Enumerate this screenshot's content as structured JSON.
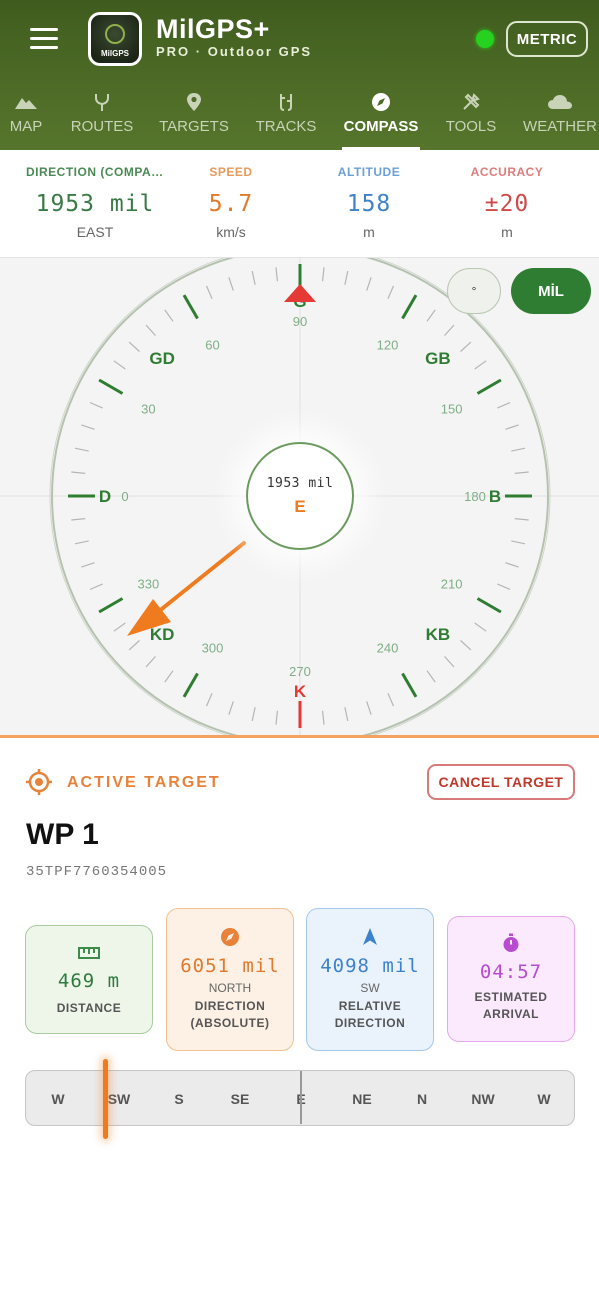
{
  "header": {
    "app_name": "MilGPS+",
    "logo_text": "MilGPS",
    "subtitle": "PRO · Outdoor GPS",
    "unit_button": "METRIC"
  },
  "tabs": [
    {
      "label": "MAP",
      "icon": "mountain-icon"
    },
    {
      "label": "ROUTES",
      "icon": "route-icon"
    },
    {
      "label": "TARGETS",
      "icon": "pin-icon"
    },
    {
      "label": "TRACKS",
      "icon": "tracks-icon"
    },
    {
      "label": "COMPASS",
      "icon": "compass-icon",
      "active": true
    },
    {
      "label": "TOOLS",
      "icon": "tools-icon"
    },
    {
      "label": "WEATHER",
      "icon": "cloud-icon"
    }
  ],
  "stats": {
    "direction": {
      "label": "DIRECTION (COMPASS)",
      "value": "1953 mil",
      "unit": "EAST"
    },
    "speed": {
      "label": "SPEED",
      "value": "5.7",
      "unit": "km/s"
    },
    "altitude": {
      "label": "ALTITUDE",
      "value": "158",
      "unit": "m"
    },
    "accuracy": {
      "label": "ACCURACY",
      "value": "±20",
      "unit": "m"
    }
  },
  "compass": {
    "unit_toggle": {
      "degree": "°",
      "mil": "MİL"
    },
    "center_value": "1953 mil",
    "center_direction": "E",
    "letters": [
      "D",
      "GD",
      "G",
      "GB",
      "B",
      "KB",
      "K",
      "KD"
    ],
    "numbers": [
      "0",
      "30",
      "60",
      "90",
      "120",
      "150",
      "180",
      "210",
      "240",
      "270",
      "300",
      "330"
    ]
  },
  "target": {
    "section_label": "ACTIVE TARGET",
    "cancel_label": "CANCEL TARGET",
    "name": "WP 1",
    "grid": "35TPF7760354005",
    "cards": {
      "distance": {
        "value": "469 m",
        "label": "DISTANCE"
      },
      "direction": {
        "value": "6051 mil",
        "sub": "NORTH",
        "label1": "DIRECTION",
        "label2": "(ABSOLUTE)"
      },
      "relative": {
        "value": "4098 mil",
        "sub": "SW",
        "label1": "RELATIVE",
        "label2": "DIRECTION"
      },
      "arrival": {
        "value": "04:57",
        "label1": "ESTIMATED",
        "label2": "ARRIVAL"
      }
    }
  },
  "strip": [
    "W",
    "SW",
    "S",
    "SE",
    "E",
    "NE",
    "N",
    "NW",
    "W"
  ],
  "colors": {
    "brand_green": "#4d6b26",
    "accent_orange": "#f07a1e",
    "alert_red": "#c0392b",
    "compass_green": "#2e7d32"
  }
}
